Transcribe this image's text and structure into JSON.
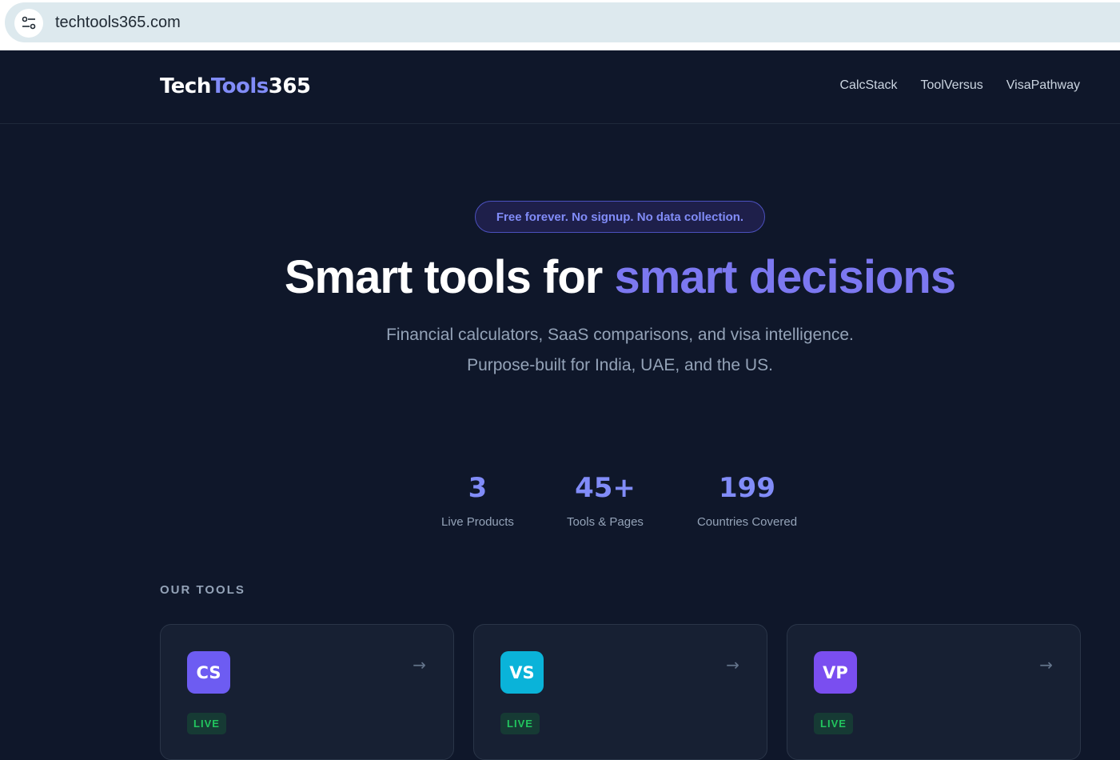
{
  "browser": {
    "url": "techtools365.com"
  },
  "header": {
    "logo_part1": "Tech",
    "logo_part2": "Tools",
    "logo_part3": "365",
    "nav": [
      "CalcStack",
      "ToolVersus",
      "VisaPathway"
    ]
  },
  "hero": {
    "badge": "Free forever. No signup. No data collection.",
    "title_plain": "Smart tools for ",
    "title_accent": "smart decisions",
    "subtitle_line1": "Financial calculators, SaaS comparisons, and visa intelligence.",
    "subtitle_line2": "Purpose-built for India, UAE, and the US."
  },
  "stats": [
    {
      "value": "3",
      "label": "Live Products"
    },
    {
      "value": "45+",
      "label": "Tools & Pages"
    },
    {
      "value": "199",
      "label": "Countries Covered"
    }
  ],
  "tools": {
    "section_label": "OUR TOOLS",
    "cards": [
      {
        "initials": "CS",
        "status": "LIVE",
        "arrow": "→",
        "color": "#6d5cf2"
      },
      {
        "initials": "VS",
        "status": "LIVE",
        "arrow": "→",
        "color": "#0ab3d9"
      },
      {
        "initials": "VP",
        "status": "LIVE",
        "arrow": "→",
        "color": "#7a4ef0"
      }
    ]
  },
  "colors": {
    "background": "#0f172a",
    "accent": "#818cf8",
    "live": "#22c55e"
  }
}
